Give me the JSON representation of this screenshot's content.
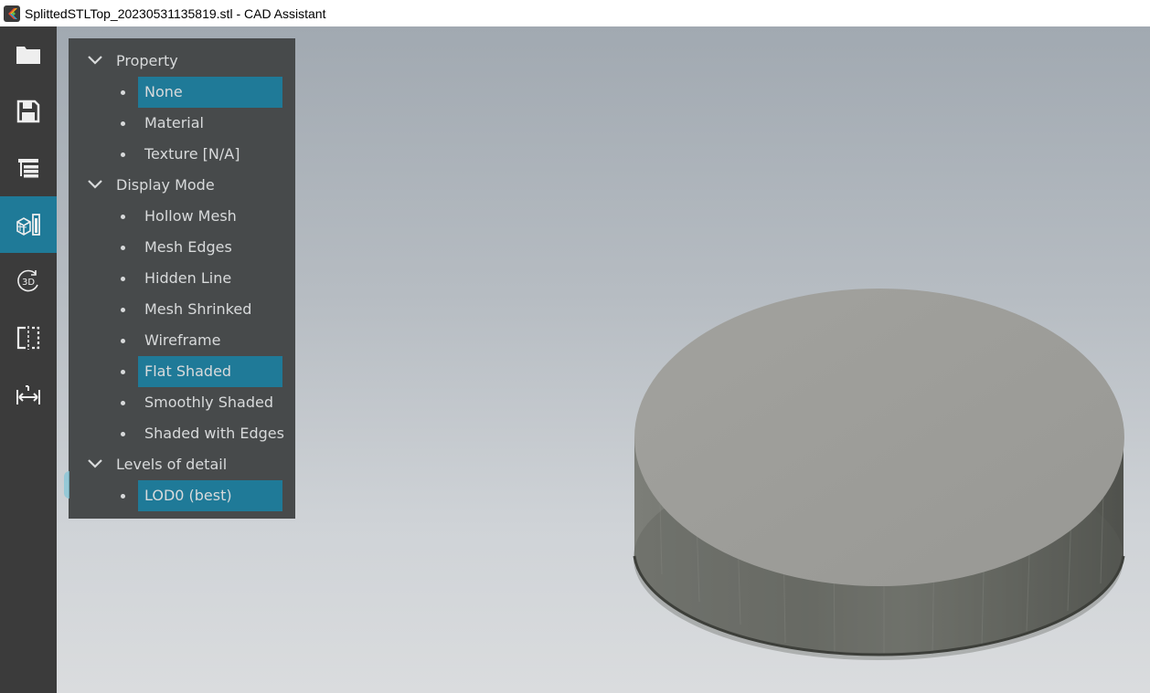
{
  "window": {
    "title": "SplittedSTLTop_20230531135819.stl - CAD Assistant"
  },
  "sidebar": {
    "buttons": [
      {
        "icon": "folder-icon",
        "active": false
      },
      {
        "icon": "save-icon",
        "active": false
      },
      {
        "icon": "model-tree-icon",
        "active": false
      },
      {
        "icon": "display-settings-icon",
        "active": true
      },
      {
        "icon": "3d-rotate-icon",
        "active": false
      },
      {
        "icon": "clipping-plane-icon",
        "active": false
      },
      {
        "icon": "measure-icon",
        "active": false
      }
    ]
  },
  "panel": {
    "groups": [
      {
        "label": "Property",
        "items": [
          {
            "label": "None",
            "selected": true
          },
          {
            "label": "Material",
            "selected": false
          },
          {
            "label": "Texture [N/A]",
            "selected": false
          }
        ]
      },
      {
        "label": "Display Mode",
        "items": [
          {
            "label": "Hollow Mesh",
            "selected": false
          },
          {
            "label": "Mesh Edges",
            "selected": false
          },
          {
            "label": "Hidden Line",
            "selected": false
          },
          {
            "label": "Mesh Shrinked",
            "selected": false
          },
          {
            "label": "Wireframe",
            "selected": false
          },
          {
            "label": "Flat Shaded",
            "selected": true
          },
          {
            "label": "Smoothly Shaded",
            "selected": false
          },
          {
            "label": "Shaded with Edges",
            "selected": false
          }
        ]
      },
      {
        "label": "Levels of detail",
        "items": [
          {
            "label": "LOD0 (best)",
            "selected": true
          }
        ]
      }
    ]
  },
  "colors": {
    "accent": "#1f7a98",
    "sidebar": "#3b3b3b",
    "panel": "#474a4b",
    "model_top": "#9b9b97",
    "model_side": "#6f716b"
  }
}
